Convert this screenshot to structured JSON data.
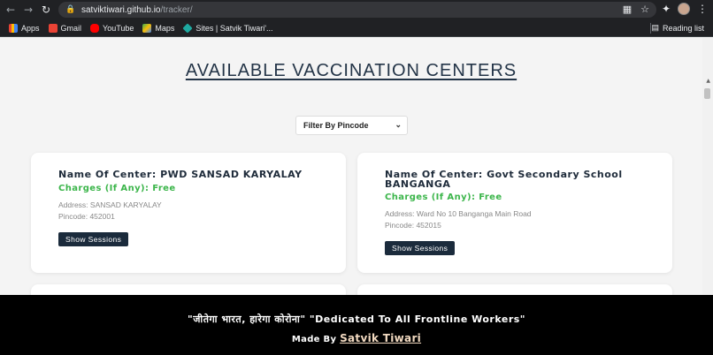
{
  "browser": {
    "url_host": "satviktiwari.github.io",
    "url_path": "/tracker/",
    "bookmarks": [
      {
        "label": "Apps",
        "color": "#ea4335"
      },
      {
        "label": "Gmail",
        "color": "#ea4335"
      },
      {
        "label": "YouTube",
        "color": "#ff0000"
      },
      {
        "label": "Maps",
        "color": "#34a853"
      },
      {
        "label": "Sites | Satvik Tiwari'...",
        "color": "#1ea9a0"
      }
    ],
    "reading_list": "Reading list"
  },
  "page": {
    "title": "AVAILABLE VACCINATION CENTERS",
    "filter": {
      "selected": "Filter By Pincode"
    },
    "centers": [
      {
        "name": "Name Of Center: PWD SANSAD KARYALAY",
        "charges": "Charges (If Any): Free",
        "address": "Address: SANSAD KARYALAY",
        "pincode": "Pincode: 452001",
        "button": "Show Sessions"
      },
      {
        "name": "Name Of Center: Govt Secondary School BANGANGA",
        "charges": "Charges (If Any): Free",
        "address": "Address: Ward No 10 Banganga Main Road",
        "pincode": "Pincode: 452015",
        "button": "Show Sessions"
      }
    ]
  },
  "footer": {
    "slogan": "\"जीतेगा भारत, हारेगा कोरोना\" \"Dedicated To All Frontline Workers\"",
    "made_by": "Made By",
    "author": "Satvik Tiwari"
  },
  "colors": {
    "accent_green": "#3bb54a",
    "button_dark": "#1b2b3c",
    "title_text": "#233447"
  }
}
